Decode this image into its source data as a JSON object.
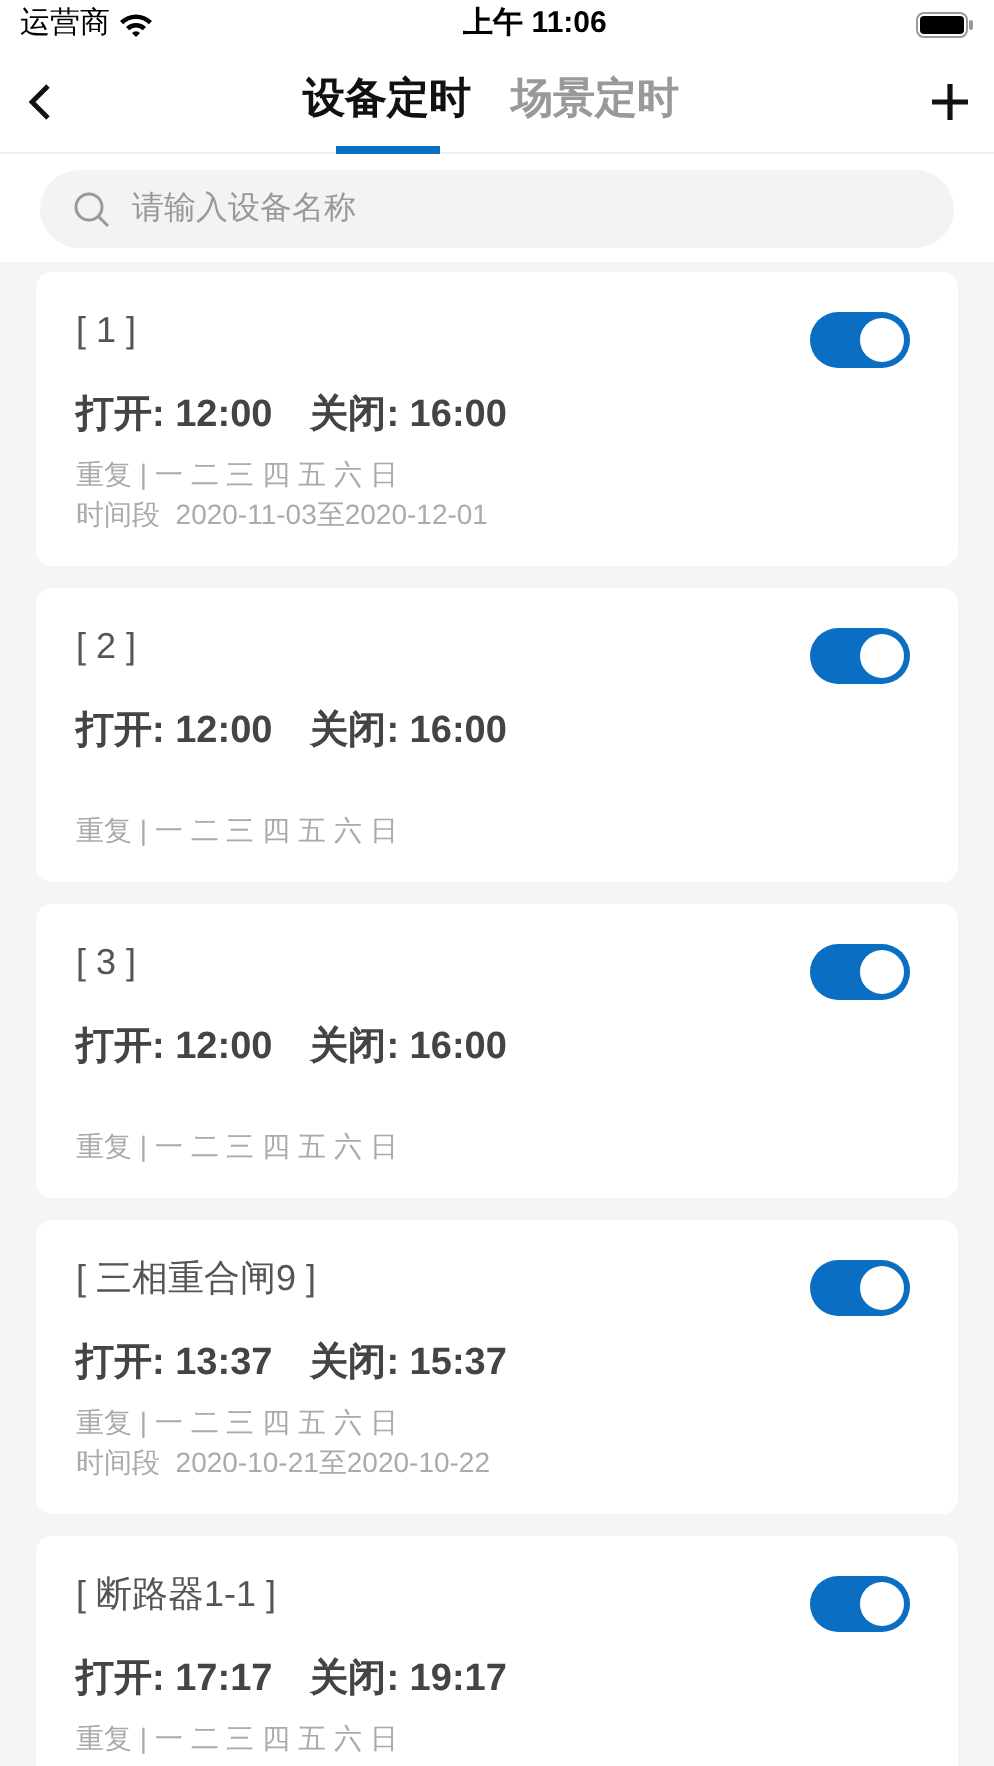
{
  "status_bar": {
    "carrier": "运营商",
    "time": "上午 11:06"
  },
  "tabs": [
    {
      "label": "设备定时",
      "selected": true
    },
    {
      "label": "场景定时",
      "selected": false
    }
  ],
  "search": {
    "placeholder": "请输入设备名称"
  },
  "timers": [
    {
      "name": "[ 1 ]",
      "on": true,
      "times": "打开: 12:00　关闭: 16:00",
      "repeat": "重复 | 一 二 三 四 五 六 日",
      "period": "时间段  2020-11-03至2020-12-01"
    },
    {
      "name": "[ 2 ]",
      "on": true,
      "times": "打开: 12:00　关闭: 16:00",
      "repeat": "重复 | 一 二 三 四 五 六 日"
    },
    {
      "name": "[ 3 ]",
      "on": true,
      "times": "打开: 12:00　关闭: 16:00",
      "repeat": "重复 | 一 二 三 四 五 六 日"
    },
    {
      "name": "[ 三相重合闸9 ]",
      "on": true,
      "times": "打开: 13:37　关闭: 15:37",
      "repeat": "重复 | 一 二 三 四 五 六 日",
      "period": "时间段  2020-10-21至2020-10-22"
    },
    {
      "name": "[ 断路器1-1 ]",
      "on": true,
      "times": "打开: 17:17　关闭: 19:17",
      "repeat": "重复 | 一 二 三 四 五 六 日"
    }
  ]
}
